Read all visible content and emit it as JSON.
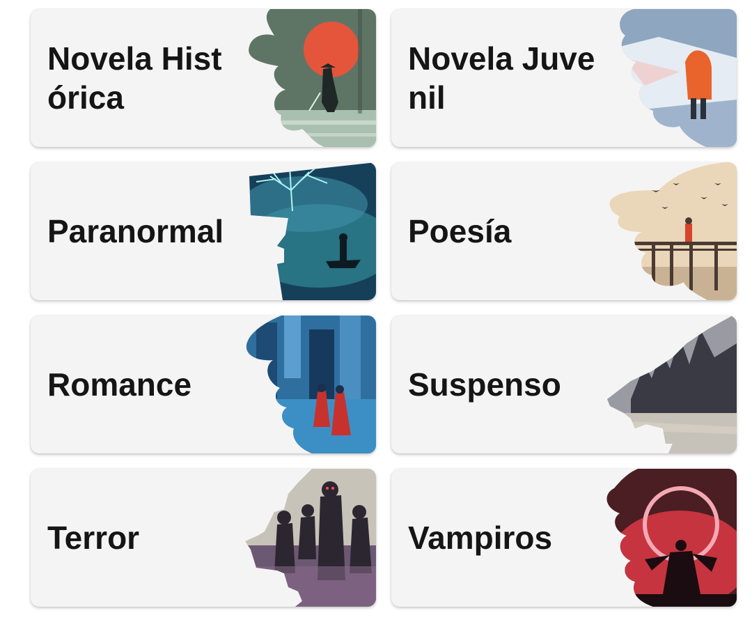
{
  "genres": [
    {
      "label": "Novela Histórica",
      "icon": "samurai-red-moon-illustration",
      "colors": {
        "sky": "#5e7565",
        "accent": "#e4553c",
        "ground": "#a9c0b0",
        "figure": "#1f2826"
      }
    },
    {
      "label": "Novela Juvenil",
      "icon": "child-in-snow-illustration",
      "colors": {
        "sky": "#8ea6bf",
        "accent": "#e8642c",
        "ground": "#e6ecf3",
        "figure": "#2a2f3a"
      }
    },
    {
      "label": "Paranormal",
      "icon": "glowing-tree-boat-illustration",
      "colors": {
        "sky": "#16405a",
        "accent": "#aef3ef",
        "ground": "#2d7f8e",
        "figure": "#0e1a22"
      }
    },
    {
      "label": "Poesía",
      "icon": "pier-with-birds-illustration",
      "colors": {
        "sky": "#ead7b9",
        "accent": "#d7432b",
        "ground": "#c9b294",
        "figure": "#4a3a32"
      }
    },
    {
      "label": "Romance",
      "icon": "couple-in-blue-city-illustration",
      "colors": {
        "sky": "#2f6f9f",
        "accent": "#c8322e",
        "ground": "#3c8fc4",
        "figure": "#1c2f4c"
      }
    },
    {
      "label": "Suspenso",
      "icon": "dark-castle-illustration",
      "colors": {
        "sky": "#9a9aa3",
        "accent": "#d9d2c4",
        "ground": "#c7c2b9",
        "figure": "#3a3a44"
      }
    },
    {
      "label": "Terror",
      "icon": "zombie-horde-illustration",
      "colors": {
        "sky": "#c8c3b8",
        "accent": "#8b6b8a",
        "ground": "#6b5873",
        "figure": "#2c2631"
      }
    },
    {
      "label": "Vampiros",
      "icon": "crimson-moon-vampire-illustration",
      "colors": {
        "sky": "#4a1e22",
        "accent": "#f3a9b4",
        "ground": "#c6343f",
        "figure": "#1a0c10"
      }
    }
  ]
}
